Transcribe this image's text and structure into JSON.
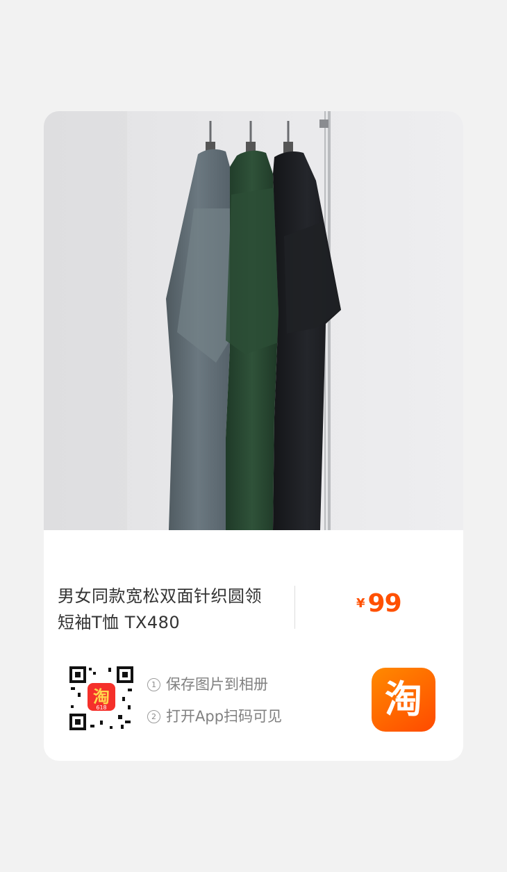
{
  "product": {
    "title_line1": "男女同款宽松双面针织圆领",
    "title_line2": "短袖T恤 TX480",
    "price_symbol": "¥",
    "price_value": "99"
  },
  "qr_icon_text": "淘",
  "qr_badge": "618",
  "steps": [
    {
      "number": "1",
      "text": "保存图片到相册"
    },
    {
      "number": "2",
      "text": "打开App扫码可见"
    }
  ],
  "taobao_logo_text": "淘",
  "colors": {
    "accent": "#ff5000",
    "shirt_colors": [
      "#5e6b72",
      "#26432f",
      "#1b1c20"
    ]
  }
}
